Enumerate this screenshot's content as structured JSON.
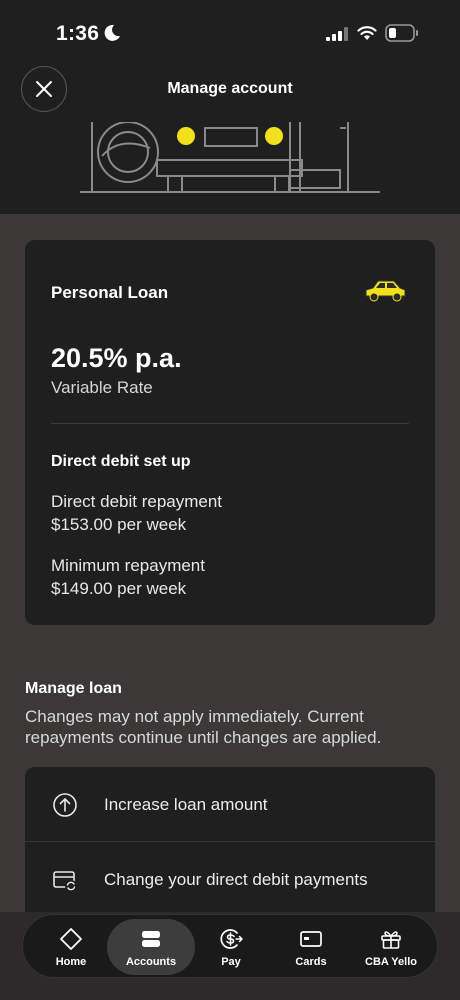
{
  "status_bar": {
    "time": "1:36"
  },
  "header": {
    "title": "Manage account"
  },
  "loan_card": {
    "title": "Personal Loan",
    "rate": "20.5% p.a.",
    "rate_type": "Variable Rate",
    "direct_debit_heading": "Direct debit set up",
    "repayment_label": "Direct debit repayment",
    "repayment_value": "$153.00 per week",
    "minimum_label": "Minimum repayment",
    "minimum_value": "$149.00 per week"
  },
  "manage_loan": {
    "title": "Manage loan",
    "description": "Changes may not apply immediately. Current repayments continue until changes are applied.",
    "actions": [
      {
        "label": "Increase loan amount",
        "icon": "arrow-up-circle-icon"
      },
      {
        "label": "Change your direct debit payments",
        "icon": "card-refresh-icon"
      }
    ]
  },
  "bottom_nav": {
    "items": [
      {
        "label": "Home",
        "icon": "home-diamond-icon"
      },
      {
        "label": "Accounts",
        "icon": "accounts-icon",
        "active": true
      },
      {
        "label": "Pay",
        "icon": "pay-icon"
      },
      {
        "label": "Cards",
        "icon": "card-icon"
      },
      {
        "label": "CBA Yello",
        "icon": "gift-icon"
      }
    ]
  },
  "colors": {
    "accent_yellow": "#f2e01c",
    "background": "#3b3838",
    "surface": "#1f1f1f"
  }
}
